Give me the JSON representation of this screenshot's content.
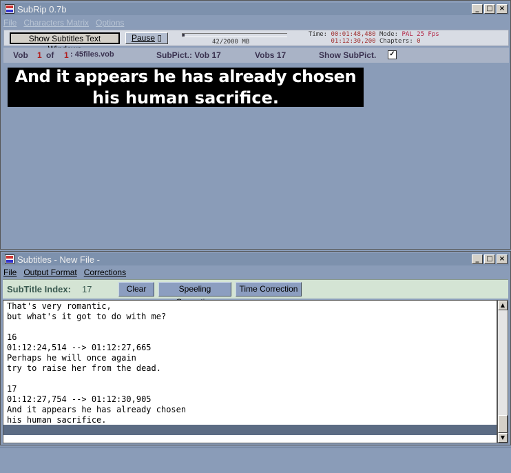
{
  "main": {
    "title": "SubRip 0.7b",
    "menu": [
      "File",
      "Characters Matrix",
      "Options"
    ],
    "toolbar": {
      "show_button": "Show Subtitles Text Windows",
      "pause_button": "Pause",
      "progress_text": "42/2000 MB",
      "time_label": "Time:",
      "time_value": "00:01:48,480",
      "time_total": "01:12:30,200",
      "mode_label": "Mode:",
      "mode_value": "PAL 25 Fps",
      "chapters_label": "Chapters:",
      "chapters_value": "0"
    },
    "info": {
      "vob_label": "Vob",
      "vob_num": "1",
      "of_label": "of",
      "vob_total": "1",
      "file": ": 45files.vob",
      "subpict_label": "SubPict.: Vob 17",
      "vobs_label": "Vobs 17",
      "show_subpict_label": "Show SubPict."
    },
    "preview": {
      "line1": "And it appears he has already chosen",
      "line2": "his human sacrifice."
    }
  },
  "subs": {
    "title": "Subtitles - New File -",
    "menu": [
      "File",
      "Output Format",
      "Corrections"
    ],
    "index_label": "SubTitle Index:",
    "index_value": "17",
    "clear_button": "Clear",
    "spell_button": "Speeling Correction",
    "time_button": "Time Correction",
    "lines": [
      "That's very romantic,",
      "but what's it got to do with me?",
      "",
      "16",
      "01:12:24,514 --> 01:12:27,665",
      "Perhaps he will once again",
      "try to raise her from the dead.",
      "",
      "17",
      "01:12:27,754 --> 01:12:30,905",
      "And it appears he has already chosen",
      "his human sacrifice."
    ]
  },
  "colors": {
    "background": "#8a9cb8",
    "titlebar": "#7d91ad",
    "selection": "#5c6c84"
  }
}
